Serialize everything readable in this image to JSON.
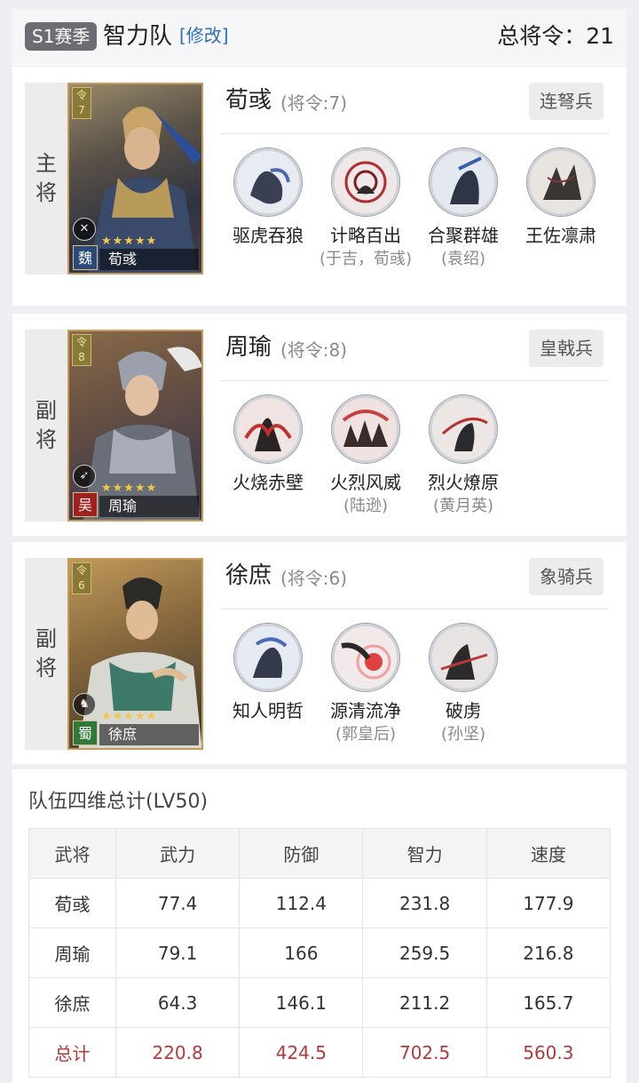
{
  "header": {
    "season_badge": "S1赛季",
    "team_name": "智力队",
    "edit_link": "[修改]",
    "total_command": "总将令：21"
  },
  "heroes": [
    {
      "role": [
        "主",
        "将"
      ],
      "name": "荀彧",
      "command": "(将令:7)",
      "troop": "连弩兵",
      "portrait": {
        "cmd": "令",
        "cmd_num": "7",
        "faction": "魏",
        "faction_color": "#2b4a7a",
        "name": "荀彧",
        "stars": "★★★★★",
        "bg_color": "#3e4250"
      },
      "skills": [
        {
          "name": "驱虎吞狼",
          "source": "",
          "icon": "tiger-skill-icon"
        },
        {
          "name": "计略百出",
          "source": "(于吉，荀彧)",
          "icon": "vortex-skill-icon"
        },
        {
          "name": "合聚群雄",
          "source": "(袁绍)",
          "icon": "gather-skill-icon"
        },
        {
          "name": "王佐凛肃",
          "source": "",
          "icon": "ink-skill-icon"
        }
      ]
    },
    {
      "role": [
        "副",
        "将"
      ],
      "name": "周瑜",
      "command": "(将令:8)",
      "troop": "皇戟兵",
      "portrait": {
        "cmd": "令",
        "cmd_num": "8",
        "faction": "吴",
        "faction_color": "#a02020",
        "name": "周瑜",
        "stars": "★★★★★",
        "bg_color": "#5a4a42"
      },
      "skills": [
        {
          "name": "火烧赤壁",
          "source": "",
          "icon": "fire-skill-icon"
        },
        {
          "name": "火烈风威",
          "source": "(陆逊)",
          "icon": "flame-skill-icon"
        },
        {
          "name": "烈火燎原",
          "source": "(黄月英)",
          "icon": "blaze-skill-icon"
        }
      ]
    },
    {
      "role": [
        "副",
        "将"
      ],
      "name": "徐庶",
      "command": "(将令:6)",
      "troop": "象骑兵",
      "portrait": {
        "cmd": "令",
        "cmd_num": "6",
        "faction": "蜀",
        "faction_color": "#2f7a3a",
        "name": "徐庶",
        "stars": "★★★★★",
        "bg_color": "#5a4a32"
      },
      "skills": [
        {
          "name": "知人明哲",
          "source": "",
          "icon": "wisdom-skill-icon"
        },
        {
          "name": "源清流净",
          "source": "(郭皇后)",
          "icon": "pure-skill-icon"
        },
        {
          "name": "破虏",
          "source": "(孙坚)",
          "icon": "strike-skill-icon"
        }
      ]
    }
  ],
  "stats": {
    "title": "队伍四维总计(LV50)",
    "columns": [
      "武将",
      "武力",
      "防御",
      "智力",
      "速度"
    ],
    "rows": [
      [
        "荀彧",
        "77.4",
        "112.4",
        "231.8",
        "177.9"
      ],
      [
        "周瑜",
        "79.1",
        "166",
        "259.5",
        "216.8"
      ],
      [
        "徐庶",
        "64.3",
        "146.1",
        "211.2",
        "165.7"
      ]
    ],
    "total": [
      "总计",
      "220.8",
      "424.5",
      "702.5",
      "560.3"
    ]
  },
  "colors": {
    "accent_link": "#2f6fb8",
    "total_row": "#b33a3a",
    "badge_bg": "#6b6d72"
  }
}
